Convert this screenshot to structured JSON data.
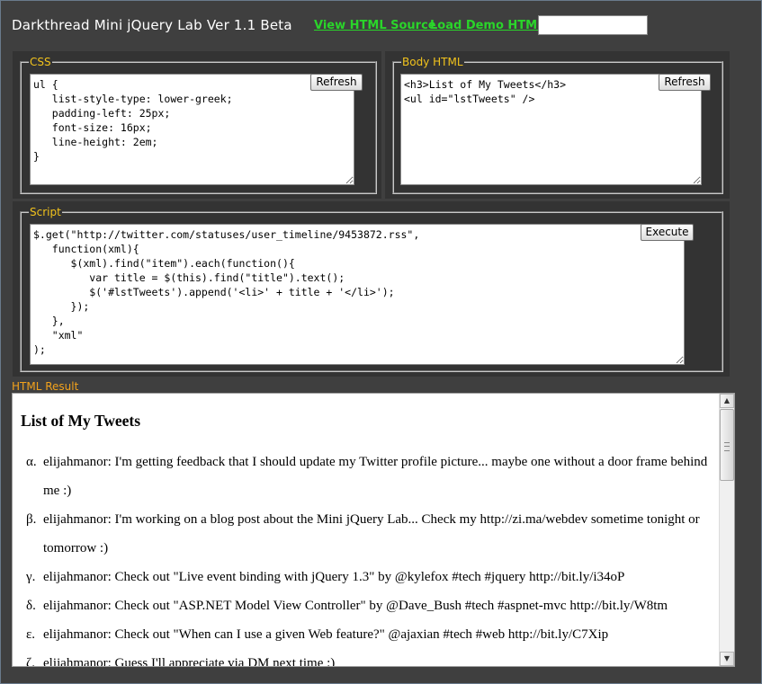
{
  "header": {
    "title": "Darkthread Mini jQuery Lab Ver 1.1 Beta",
    "view_source_link": "View HTML Source",
    "load_demo_link": "Load Demo HTML",
    "input_value": ""
  },
  "css_panel": {
    "legend": "CSS",
    "code": "ul {\n   list-style-type: lower-greek;\n   padding-left: 25px;\n   font-size: 16px;\n   line-height: 2em;\n}",
    "refresh_label": "Refresh"
  },
  "html_panel": {
    "legend": "Body HTML",
    "code": "<h3>List of My Tweets</h3>\n<ul id=\"lstTweets\" />",
    "refresh_label": "Refresh"
  },
  "script_panel": {
    "legend": "Script",
    "code": "$.get(\"http://twitter.com/statuses/user_timeline/9453872.rss\",\n   function(xml){\n      $(xml).find(\"item\").each(function(){\n         var title = $(this).find(\"title\").text();\n         $('#lstTweets').append('<li>' + title + '</li>');\n      });\n   },\n   \"xml\"\n);",
    "execute_label": "Execute"
  },
  "result": {
    "label": "HTML Result",
    "heading": "List of My Tweets",
    "tweets": [
      {
        "marker": "α.",
        "text": "elijahmanor: I'm getting feedback that I should update my Twitter profile picture... maybe one without a door frame behind me :)"
      },
      {
        "marker": "β.",
        "text": "elijahmanor: I'm working on a blog post about the Mini jQuery Lab... Check my http://zi.ma/webdev sometime tonight or tomorrow :)"
      },
      {
        "marker": "γ.",
        "text": "elijahmanor: Check out \"Live event binding with jQuery 1.3\" by @kylefox #tech #jquery http://bit.ly/i34oP"
      },
      {
        "marker": "δ.",
        "text": "elijahmanor: Check out \"ASP.NET Model View Controller\" by @Dave_Bush #tech #aspnet-mvc http://bit.ly/W8tm"
      },
      {
        "marker": "ε.",
        "text": "elijahmanor: Check out \"When can I use a given Web feature?\" @ajaxian #tech #web http://bit.ly/C7Xip"
      },
      {
        "marker": "ζ.",
        "text": "elijahmanor: Guess I'll appreciate via DM next time :)"
      }
    ],
    "scroll_up_icon": "up-arrow-icon",
    "scroll_down_icon": "down-arrow-icon"
  }
}
